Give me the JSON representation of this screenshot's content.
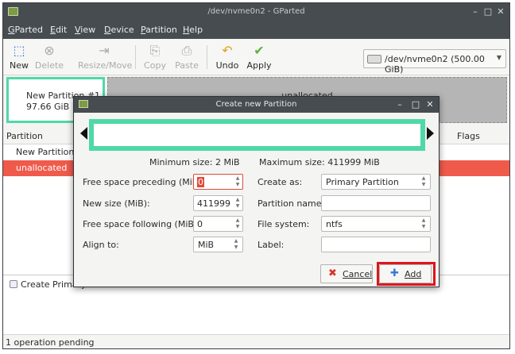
{
  "window": {
    "title": "/dev/nvme0n2 - GParted",
    "controls": {
      "minimize": "–",
      "maximize": "□",
      "close": "✕"
    }
  },
  "menu": [
    "GParted",
    "Edit",
    "View",
    "Device",
    "Partition",
    "Help"
  ],
  "toolbar": {
    "new": "New",
    "delete": "Delete",
    "resize_move": "Resize/Move",
    "copy": "Copy",
    "paste": "Paste",
    "undo": "Undo",
    "apply": "Apply",
    "device": "/dev/nvme0n2  (500.00 GiB)"
  },
  "graph": {
    "new_partition_name": "New Partition #1",
    "new_partition_size": "97.66 GiB",
    "unallocated": "unallocated"
  },
  "table": {
    "headers": {
      "partition": "Partition",
      "flags": "Flags"
    },
    "rows": [
      "New Partition #1",
      "unallocated"
    ]
  },
  "pending": {
    "operation": "Create Primary",
    "status": "1 operation pending"
  },
  "dialog": {
    "title": "Create new Partition",
    "min_size": "Minimum size: 2 MiB",
    "max_size": "Maximum size: 411999 MiB",
    "labels": {
      "preceding": "Free space preceding (MiB):",
      "new_size": "New size (MiB):",
      "following": "Free space following (MiB):",
      "align": "Align to:",
      "create_as": "Create as:",
      "part_name": "Partition name:",
      "fs": "File system:",
      "label": "Label:"
    },
    "values": {
      "preceding": "0",
      "new_size": "411999",
      "following": "0",
      "align": "MiB",
      "create_as": "Primary Partition",
      "fs": "ntfs"
    },
    "buttons": {
      "cancel": "Cancel",
      "add": "Add"
    }
  },
  "colors": {
    "accent_border": "#4fd8a8",
    "selected_row": "#f05a4b",
    "highlight": "#e0141b"
  }
}
